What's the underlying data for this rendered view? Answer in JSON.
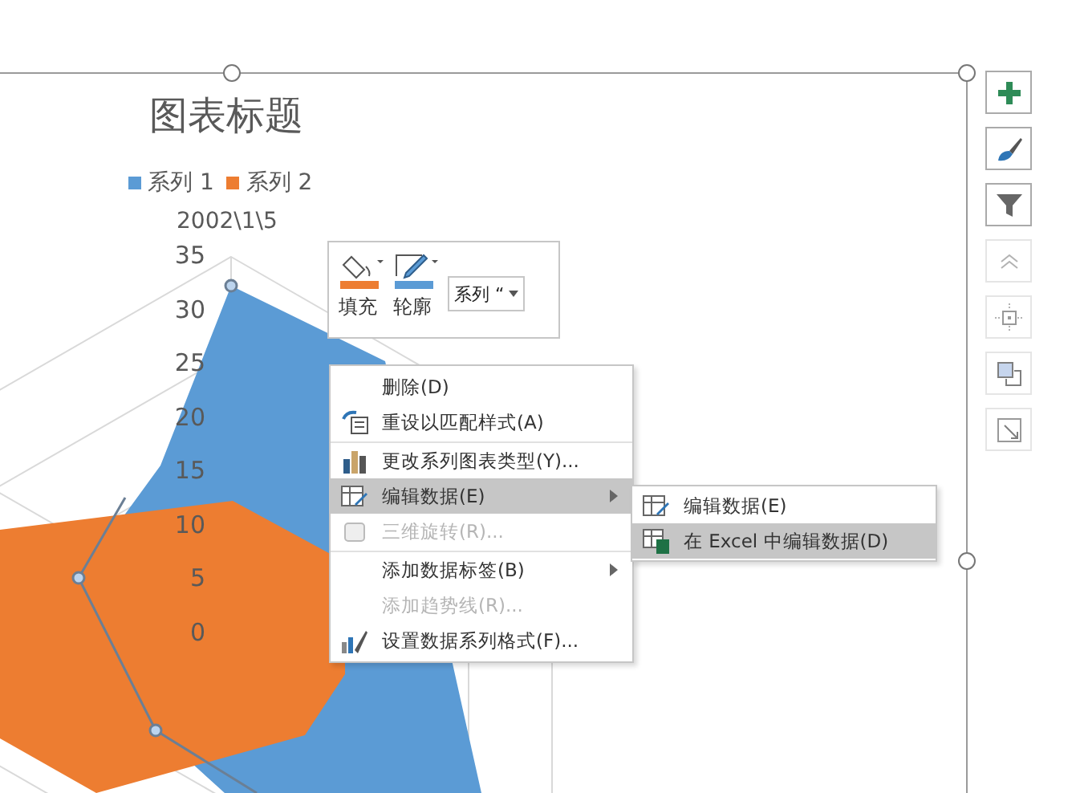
{
  "chart": {
    "title": "图表标题",
    "legend": [
      {
        "label": "系列 1",
        "color": "#5b9bd5"
      },
      {
        "label": "系列 2",
        "color": "#ed7d31"
      }
    ],
    "category_label": "2002\\1\\5",
    "axis_labels": [
      "35",
      "30",
      "25",
      "20",
      "15",
      "10",
      "5",
      "0"
    ]
  },
  "mini_toolbar": {
    "fill_label": "填充",
    "outline_label": "轮廓",
    "series_select": "系列 “"
  },
  "context_menu": [
    {
      "label": "删除(D)",
      "disabled": false,
      "selected": false,
      "submenu": false,
      "separator_before": false
    },
    {
      "label": "重设以匹配样式(A)",
      "disabled": false,
      "selected": false,
      "submenu": false,
      "separator_before": false
    },
    {
      "label": "更改系列图表类型(Y)...",
      "disabled": false,
      "selected": false,
      "submenu": false,
      "separator_before": true
    },
    {
      "label": "编辑数据(E)",
      "disabled": false,
      "selected": true,
      "submenu": true,
      "separator_before": false
    },
    {
      "label": "三维旋转(R)...",
      "disabled": true,
      "selected": false,
      "submenu": false,
      "separator_before": false
    },
    {
      "label": "添加数据标签(B)",
      "disabled": false,
      "selected": false,
      "submenu": true,
      "separator_before": true
    },
    {
      "label": "添加趋势线(R)...",
      "disabled": true,
      "selected": false,
      "submenu": false,
      "separator_before": false
    },
    {
      "label": "设置数据系列格式(F)...",
      "disabled": false,
      "selected": false,
      "submenu": false,
      "separator_before": false
    }
  ],
  "submenu": [
    {
      "label": "编辑数据(E)",
      "selected": false
    },
    {
      "label": "在 Excel 中编辑数据(D)",
      "selected": true
    }
  ],
  "side_buttons": [
    {
      "disabled": false
    },
    {
      "disabled": false
    },
    {
      "disabled": false
    },
    {
      "disabled": true
    },
    {
      "disabled": true
    },
    {
      "disabled": true
    },
    {
      "disabled": true
    }
  ]
}
